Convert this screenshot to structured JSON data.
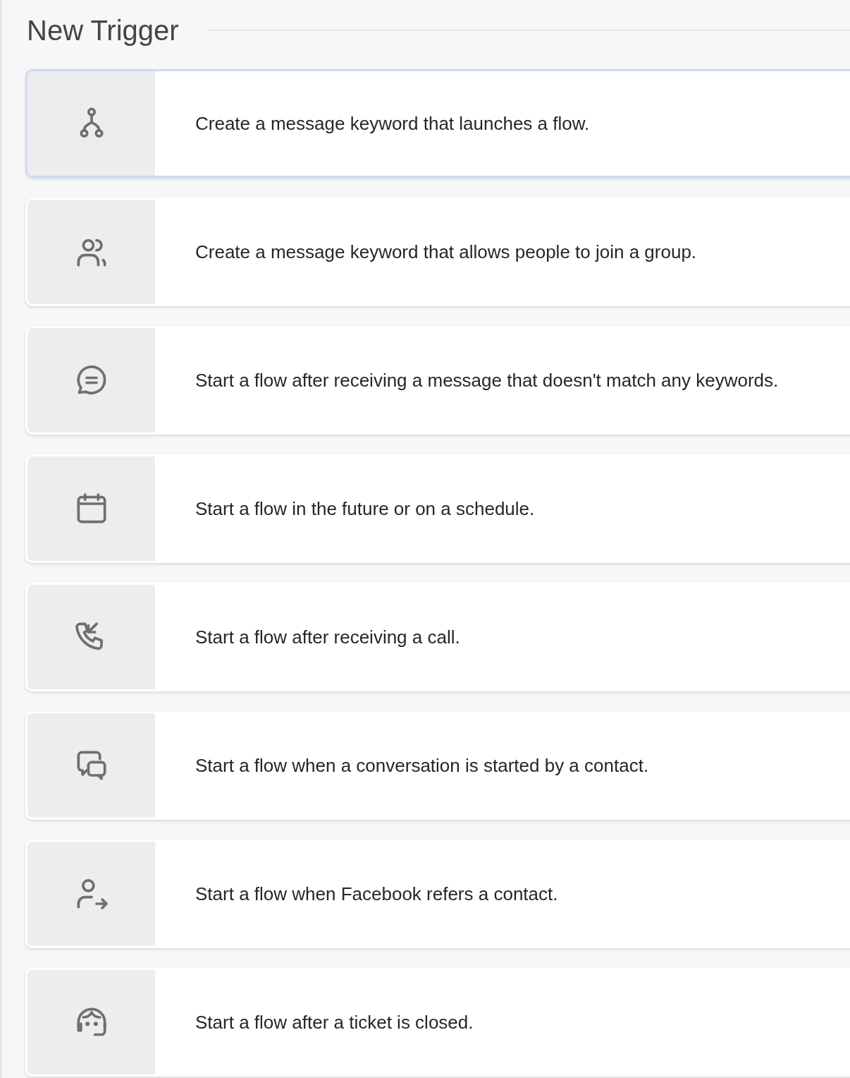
{
  "title": "New Trigger",
  "options": [
    {
      "kind": "keyword",
      "label": "Create a message keyword that launches a flow.",
      "selected": true
    },
    {
      "kind": "join",
      "label": "Create a message keyword that allows people to join a group.",
      "selected": false
    },
    {
      "kind": "catchall",
      "label": "Start a flow after receiving a message that doesn't match any keywords.",
      "selected": false
    },
    {
      "kind": "schedule",
      "label": "Start a flow in the future or on a schedule.",
      "selected": false
    },
    {
      "kind": "call",
      "label": "Start a flow after receiving a call.",
      "selected": false
    },
    {
      "kind": "conversation",
      "label": "Start a flow when a conversation is started by a contact.",
      "selected": false
    },
    {
      "kind": "referral",
      "label": "Start a flow when Facebook refers a contact.",
      "selected": false
    },
    {
      "kind": "ticket",
      "label": "Start a flow after a ticket is closed.",
      "selected": false
    }
  ]
}
